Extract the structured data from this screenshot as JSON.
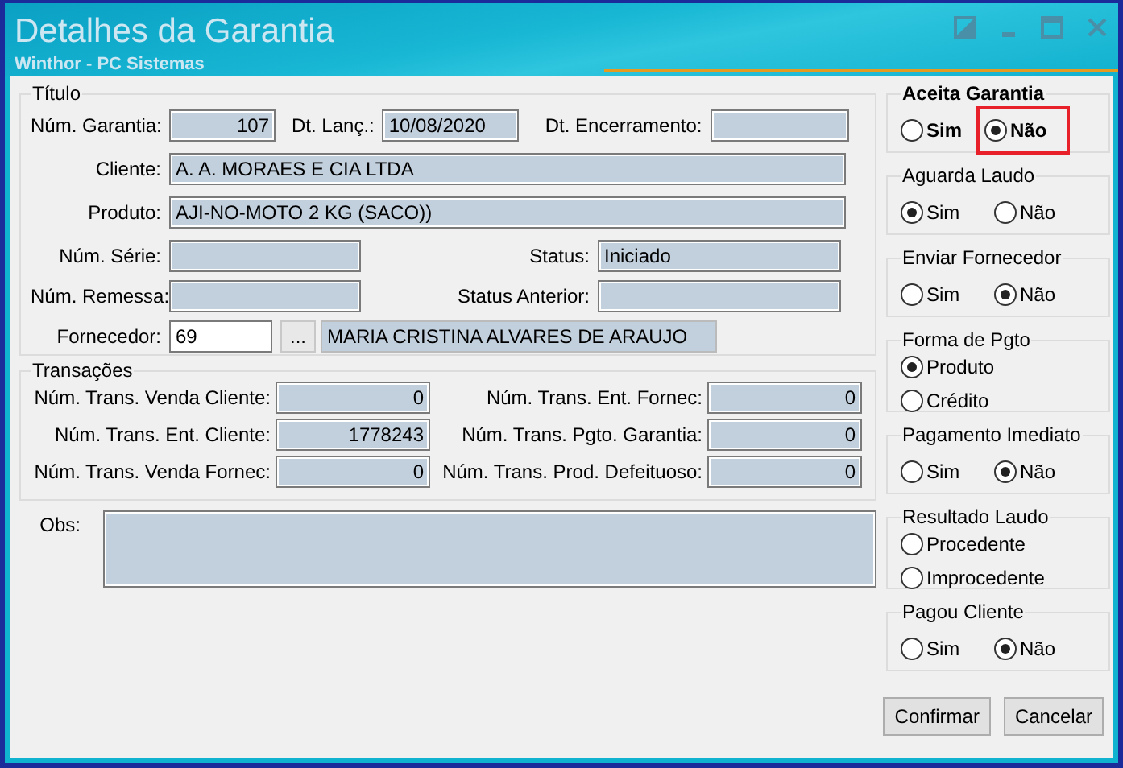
{
  "window": {
    "title": "Detalhes da Garantia",
    "subtitle": "Winthor - PC Sistemas"
  },
  "titulo": {
    "title": "Título",
    "garantia": {
      "label": "Núm. Garantia:",
      "value": "107"
    },
    "lanc": {
      "label": "Dt. Lanç.:",
      "value": "10/08/2020"
    },
    "encerramento": {
      "label": "Dt. Encerramento:"
    },
    "cliente": {
      "label": "Cliente:",
      "value": "A. A. MORAES E CIA LTDA"
    },
    "produto": {
      "label": "Produto:",
      "value": "AJI-NO-MOTO 2 KG (SACO))"
    },
    "serie": {
      "label": "Núm. Série:"
    },
    "status": {
      "label": "Status:",
      "value": "Iniciado"
    },
    "remessa": {
      "label": "Núm. Remessa:"
    },
    "status_anterior": {
      "label": "Status Anterior:"
    },
    "fornecedor": {
      "label": "Fornecedor:",
      "code": "69",
      "button": "...",
      "name": "MARIA CRISTINA ALVARES DE ARAUJO"
    }
  },
  "transacoes": {
    "title": "Transações",
    "fields": [
      {
        "label": "Núm. Trans. Venda Cliente:",
        "value": "0"
      },
      {
        "label": "Núm. Trans. Ent. Fornec:",
        "value": "0"
      },
      {
        "label": "Núm. Trans. Ent. Cliente:",
        "value": "1778243"
      },
      {
        "label": "Núm. Trans. Pgto. Garantia:",
        "value": "0"
      },
      {
        "label": "Núm. Trans. Venda Fornec:",
        "value": "0"
      },
      {
        "label": "Núm. Trans. Prod. Defeituoso:",
        "value": "0"
      }
    ]
  },
  "obs": {
    "label": "Obs:"
  },
  "groups": [
    {
      "title": "Aceita Garantia",
      "bold": true,
      "kind": "inline",
      "options": [
        {
          "label": "Sim",
          "selected": false,
          "highlighted": false
        },
        {
          "label": "Não",
          "selected": true,
          "highlighted": true
        }
      ]
    },
    {
      "title": "Aguarda Laudo",
      "bold": false,
      "kind": "inline",
      "options": [
        {
          "label": "Sim",
          "selected": true
        },
        {
          "label": "Não",
          "selected": false
        }
      ]
    },
    {
      "title": "Enviar Fornecedor",
      "bold": false,
      "kind": "inline",
      "options": [
        {
          "label": "Sim",
          "selected": false
        },
        {
          "label": "Não",
          "selected": true
        }
      ]
    },
    {
      "title": "Forma de Pgto",
      "bold": false,
      "kind": "stacked",
      "options": [
        {
          "label": "Produto",
          "selected": true
        },
        {
          "label": "Crédito",
          "selected": false
        }
      ]
    },
    {
      "title": "Pagamento Imediato",
      "bold": false,
      "kind": "inline",
      "options": [
        {
          "label": "Sim",
          "selected": false
        },
        {
          "label": "Não",
          "selected": true
        }
      ]
    },
    {
      "title": "Resultado Laudo",
      "bold": false,
      "kind": "stacked",
      "options": [
        {
          "label": "Procedente",
          "selected": false
        },
        {
          "label": "Improcedente",
          "selected": false
        }
      ]
    },
    {
      "title": "Pagou Cliente",
      "bold": false,
      "kind": "inline",
      "options": [
        {
          "label": "Sim",
          "selected": false
        },
        {
          "label": "Não",
          "selected": true
        }
      ]
    }
  ],
  "buttons": [
    "Confirmar",
    "Cancelar"
  ]
}
